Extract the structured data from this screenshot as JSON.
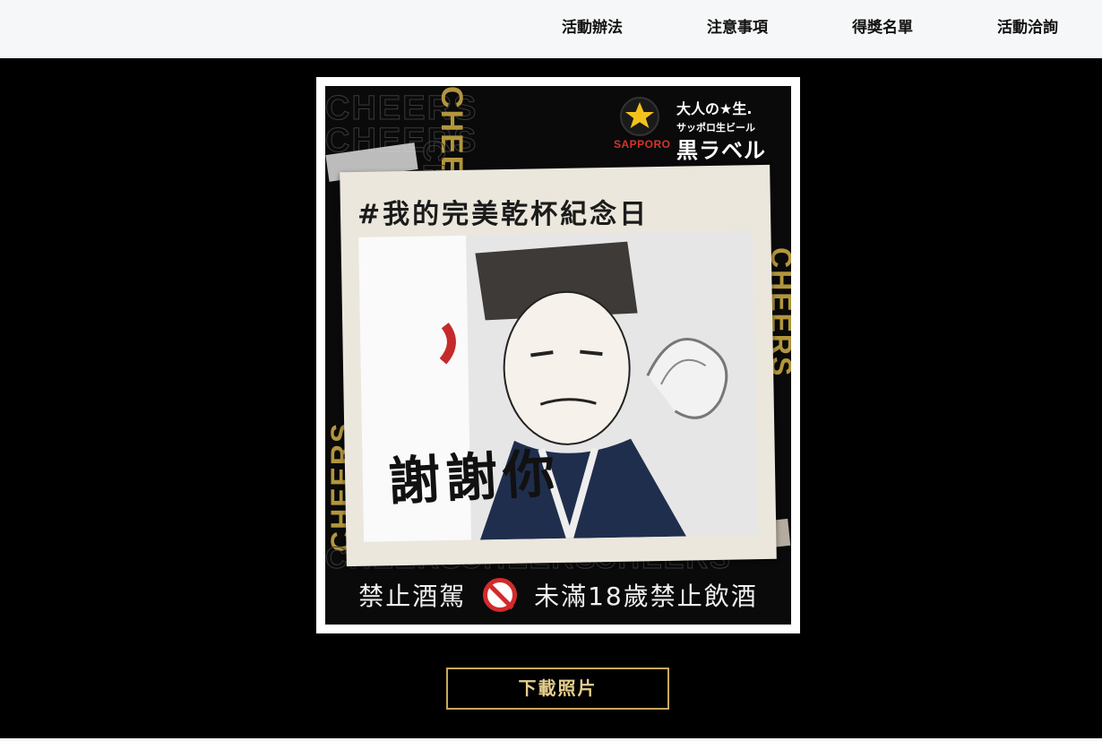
{
  "nav": {
    "items": [
      {
        "label": "活動辦法"
      },
      {
        "label": "注意事項"
      },
      {
        "label": "得獎名單"
      },
      {
        "label": "活動洽詢"
      }
    ]
  },
  "poster": {
    "brand": "SAPPORO",
    "tagline_line1": "大人の★生.",
    "tagline_line2": "サッポロ生ビール",
    "tagline_line3": "黒ラベル",
    "background_word": "CHEERS",
    "hashtag": "#我的完美乾杯紀念日",
    "illustration_text": "謝謝你",
    "warning_left": "禁止酒駕",
    "warning_right": "未滿18歲禁止飲酒"
  },
  "download": {
    "label": "下載照片"
  },
  "colors": {
    "nav_bg": "#f6f7f8",
    "page_bg": "#000000",
    "gold": "#c9a85c",
    "brand_red": "#d4342a"
  }
}
